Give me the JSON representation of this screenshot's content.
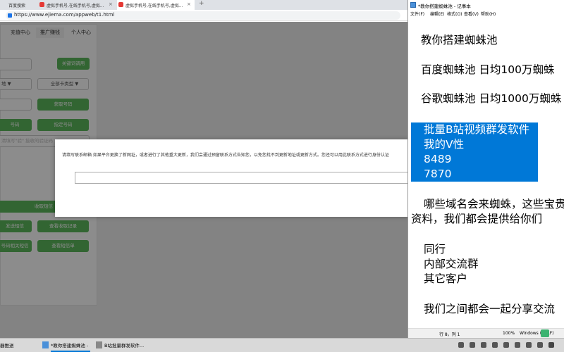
{
  "browser": {
    "tabs": [
      {
        "label": "百度搜索"
      },
      {
        "label": "虚拟手机号,在线手机号,虚拟..."
      },
      {
        "label": "虚拟手机号,在线手机号,虚拟..."
      }
    ],
    "url": "https://www.ejiema.com/appweb/t1.html",
    "panel": {
      "nav": [
        "充值中心",
        "推广赚钱",
        "个人中心"
      ],
      "btn_keyword": "关键词调用",
      "select_area": "地 ▼",
      "select_type": "全部卡类型 ▼",
      "btn_get_number": "获取号码",
      "btn_a": "号码",
      "btn_specify": "指定号码",
      "placeholder_code": "清填写\"验\" 接收的验证码",
      "btn_receive": "收取短信",
      "btn_send": "发送短信",
      "btn_view_receive": "查看收取记录",
      "btn_related": "号码相关短信",
      "btn_view_send": "查看短信单"
    },
    "modal": {
      "message": "请填写联系邮箱 如果平台更换了新网址，或者进行了其他重大更新，我们会通过预留联系方式告知您，以免您找不到更新地址或更新方式。您还可以用此联系方式进行身份认证"
    }
  },
  "notepad": {
    "title": "*教你搭建蜘蛛池 - 记事本",
    "menu": [
      "文件(F)",
      "编辑(E)",
      "格式(O)",
      "查看(V)",
      "帮助(H)"
    ],
    "lines": [
      "教你搭建蜘蛛池",
      "百度蜘蛛池   日均100万蜘蛛",
      "谷歌蜘蛛池   日均1000万蜘蛛",
      "批量B站视频群发软件",
      "我的V性",
      "8489",
      "7870",
      "哪些域名会来蜘蛛，这些宝贵",
      "资料，我们都会提供给你们",
      "同行",
      "内部交流群",
      "其它客户",
      "我们之间都会一起分享交流"
    ],
    "status": {
      "position": "行 8，列 1",
      "zoom": "100%",
      "encoding": "Windows (CRLF)"
    }
  },
  "taskbar": {
    "items": [
      "器推送",
      "*教你搭建蜘蛛池 - ...",
      "B站批量群发软件..."
    ]
  },
  "colors": {
    "accent_green": "#5cb85c",
    "selection": "#0078d7"
  }
}
